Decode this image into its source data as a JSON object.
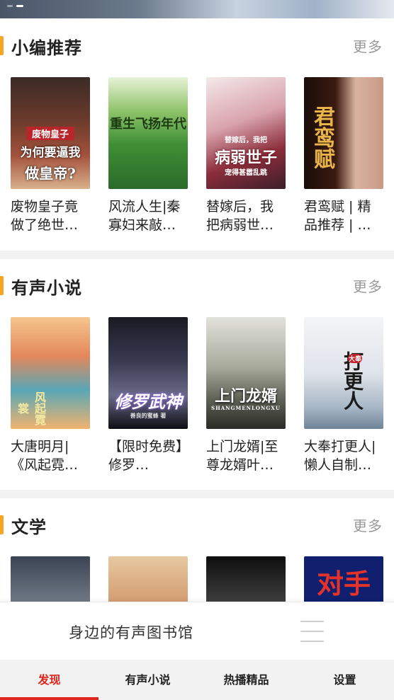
{
  "sections": [
    {
      "title": "小编推荐",
      "more": "更多",
      "books": [
        {
          "title": "废物皇子竟做了绝世…",
          "cover_text": [
            "废物皇子",
            "为何要逼我",
            "做皇帝?"
          ]
        },
        {
          "title": "风流人生|秦寡妇来敲…",
          "cover_text": [
            "重生飞扬年代"
          ]
        },
        {
          "title": "替嫁后，我把病弱世…",
          "cover_text": [
            "替嫁后，我把",
            "病弱世子",
            "宠得甚嚣乱跳"
          ]
        },
        {
          "title": "君鸾赋 | 精品推荐 | …",
          "cover_text": [
            "君鸾赋"
          ]
        }
      ]
    },
    {
      "title": "有声小说",
      "more": "更多",
      "books": [
        {
          "title": "大唐明月|《风起霓…",
          "cover_text": [
            "风起霓裳"
          ]
        },
        {
          "title": "【限时免费】修罗…",
          "cover_text": [
            "修罗武神",
            "善良的蜜蜂 著"
          ]
        },
        {
          "title": "上门龙婿|至尊龙婿叶…",
          "cover_text": [
            "上门龙婿",
            "SHANGMENLONGXU"
          ]
        },
        {
          "title": "大奉打更人|懒人自制…",
          "cover_text": [
            "打更人",
            "大奉"
          ]
        }
      ]
    },
    {
      "title": "文学",
      "more": "更多",
      "books": [
        {
          "title": "",
          "cover_text": []
        },
        {
          "title": "",
          "cover_text": []
        },
        {
          "title": "",
          "cover_text": []
        },
        {
          "title": "",
          "cover_text": [
            "对手"
          ]
        }
      ]
    }
  ],
  "player": {
    "text": "身边的有声图书馆"
  },
  "tabs": [
    {
      "label": "发现",
      "active": true
    },
    {
      "label": "有声小说",
      "active": false
    },
    {
      "label": "热播精品",
      "active": false
    },
    {
      "label": "设置",
      "active": false
    }
  ],
  "colors": {
    "accent": "#e0261c",
    "section_bar": "#f5a623",
    "more_text": "#999999",
    "tab_bg": "#f2f2f2"
  },
  "icons": {
    "player_menu": "list-menu-icon"
  }
}
